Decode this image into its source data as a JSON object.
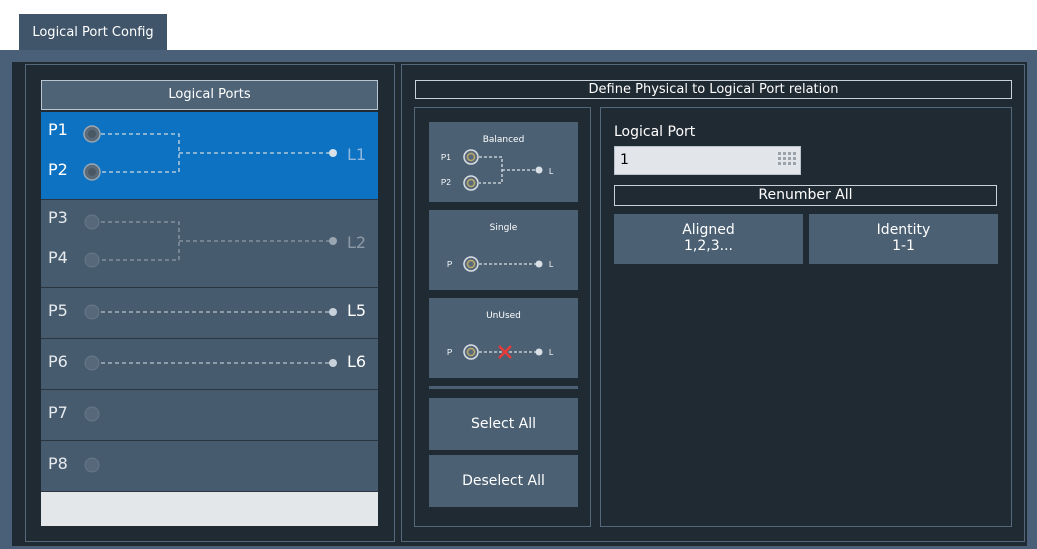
{
  "tab": {
    "label": "Logical Port Config"
  },
  "logical_ports": {
    "header": "Logical Ports",
    "rows": [
      {
        "ports": [
          "P1",
          "P2"
        ],
        "logical": "L1",
        "type": "balanced",
        "selected": true
      },
      {
        "ports": [
          "P3",
          "P4"
        ],
        "logical": "L2",
        "type": "balanced",
        "selected": false
      },
      {
        "ports": [
          "P5"
        ],
        "logical": "L5",
        "type": "single",
        "selected": false
      },
      {
        "ports": [
          "P6"
        ],
        "logical": "L6",
        "type": "single",
        "selected": false
      },
      {
        "ports": [
          "P7"
        ],
        "logical": "",
        "type": "unused",
        "selected": false
      },
      {
        "ports": [
          "P8"
        ],
        "logical": "",
        "type": "unused",
        "selected": false
      }
    ]
  },
  "define": {
    "header": "Define Physical to Logical Port relation",
    "types": [
      {
        "caption": "Balanced",
        "p1": "P1",
        "p2": "P2",
        "l": "L"
      },
      {
        "caption": "Single",
        "p": "P",
        "l": "L"
      },
      {
        "caption": "UnUsed",
        "p": "P",
        "l": "L"
      }
    ],
    "select_all": "Select All",
    "deselect_all": "Deselect All"
  },
  "logical_port": {
    "label": "Logical Port",
    "value": "1",
    "renumber_all": "Renumber All",
    "aligned": {
      "line1": "Aligned",
      "line2": "1,2,3..."
    },
    "identity": {
      "line1": "Identity",
      "line2": "1-1"
    }
  },
  "colors": {
    "selected_row": "#0d72c2",
    "row_bg": "#475b6e",
    "panel_bg": "#202a33",
    "connector_ring": "#b9a96a",
    "unused_x": "#e53b3b"
  }
}
